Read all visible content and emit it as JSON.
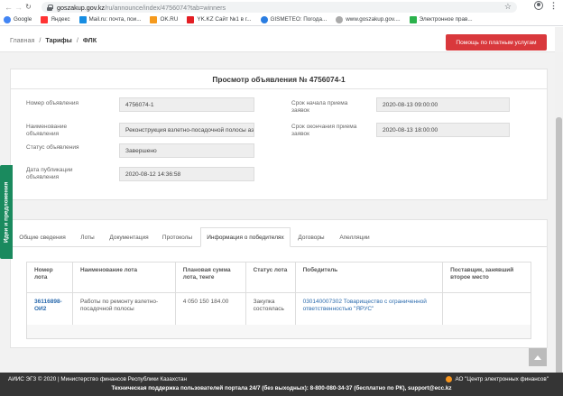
{
  "browser": {
    "url_host": "goszakup.gov.kz",
    "url_path": "/ru/announce/index/4756074?tab=winners",
    "bookmarks": [
      {
        "label": "Google",
        "icon": "google-icon"
      },
      {
        "label": "Яндекс",
        "icon": "yandex-icon"
      },
      {
        "label": "Mail.ru: почта, пои...",
        "icon": "mail-icon"
      },
      {
        "label": "OK.RU",
        "icon": "ok-icon"
      },
      {
        "label": "YK.KZ Сайт №1 в г...",
        "icon": "yk-icon"
      },
      {
        "label": "GISMETEO: Погода...",
        "icon": "gismeteo-icon"
      },
      {
        "label": "www.goszakup.gov....",
        "icon": "globe-icon"
      },
      {
        "label": "Электронное прав...",
        "icon": "egov-icon"
      }
    ]
  },
  "breadcrumb": {
    "home": "Главная",
    "sep": "/",
    "tariffs": "Тарифы",
    "current": "ФЛК"
  },
  "paid_button": "Помощь по платным услугам",
  "feedback_tab": "Идеи и предложения",
  "announcement": {
    "title": "Просмотр объявления № 4756074-1",
    "fields": {
      "number_label": "Номер объявления",
      "number_value": "4756074-1",
      "name_label": "Наименование объявления",
      "name_value": "Реконструкция взлетно-посадочной полосы аэ",
      "status_label": "Статус объявления",
      "status_value": "Завершено",
      "pub_label": "Дата публикации объявления",
      "pub_value": "2020-08-12 14:36:58",
      "start_label": "Срок начала приема заявок",
      "start_value": "2020-08-13 09:00:00",
      "end_label": "Срок окончания приема заявок",
      "end_value": "2020-08-13 18:00:00"
    }
  },
  "tabs": [
    "Общие сведения",
    "Лоты",
    "Документация",
    "Протоколы",
    "Информация о победителях",
    "Договоры",
    "Апелляции"
  ],
  "active_tab": "Информация о победителях",
  "winners_table": {
    "headers": [
      "Номер лота",
      "Наименование лота",
      "Плановая сумма лота, тенге",
      "Статус лота",
      "Победитель",
      "Поставщик, занявший второе место"
    ],
    "rows": [
      {
        "lot_number": "36116898-ОИ2",
        "lot_name": "Работы по ремонту взлетно-посадочной полосы",
        "amount": "4 050 150 184.00",
        "status": "Закупка состоялась",
        "winner": "030140007302 Товарищество с ограниченной ответственностью \"ЯРУС\"",
        "second": ""
      }
    ]
  },
  "footer": {
    "left": "АИИС ЭГЗ © 2020 | Министерство финансов Республики Казахстан",
    "right": "АО \"Центр электронных финансов\"",
    "center": "Техническая поддержка пользователей портала 24/7 (без выходных): 8-800-080-34-37 (бесплатно по РК), support@ecc.kz"
  }
}
